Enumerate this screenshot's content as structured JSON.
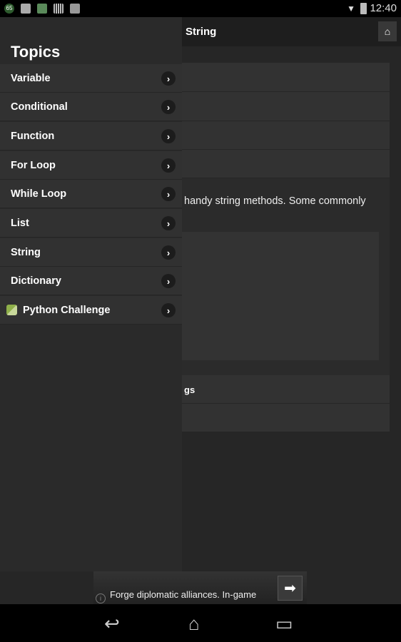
{
  "status_bar": {
    "time": "12:40",
    "notification_badge": "65"
  },
  "action_bar": {
    "title": "String"
  },
  "content": {
    "paragraph": "handy string methods. Some commonly",
    "row_fragment": "gs"
  },
  "drawer": {
    "title": "Topics",
    "items": [
      {
        "label": "Variable"
      },
      {
        "label": "Conditional"
      },
      {
        "label": "Function"
      },
      {
        "label": "For Loop"
      },
      {
        "label": "While Loop"
      },
      {
        "label": "List"
      },
      {
        "label": "String"
      },
      {
        "label": "Dictionary"
      },
      {
        "label": "Python Challenge",
        "icon": "python-icon"
      }
    ]
  },
  "ad": {
    "text": "Forge diplomatic alliances. In-game",
    "info": "i"
  },
  "nav": {
    "back": "back-icon",
    "home": "home-icon",
    "recents": "recents-icon"
  }
}
